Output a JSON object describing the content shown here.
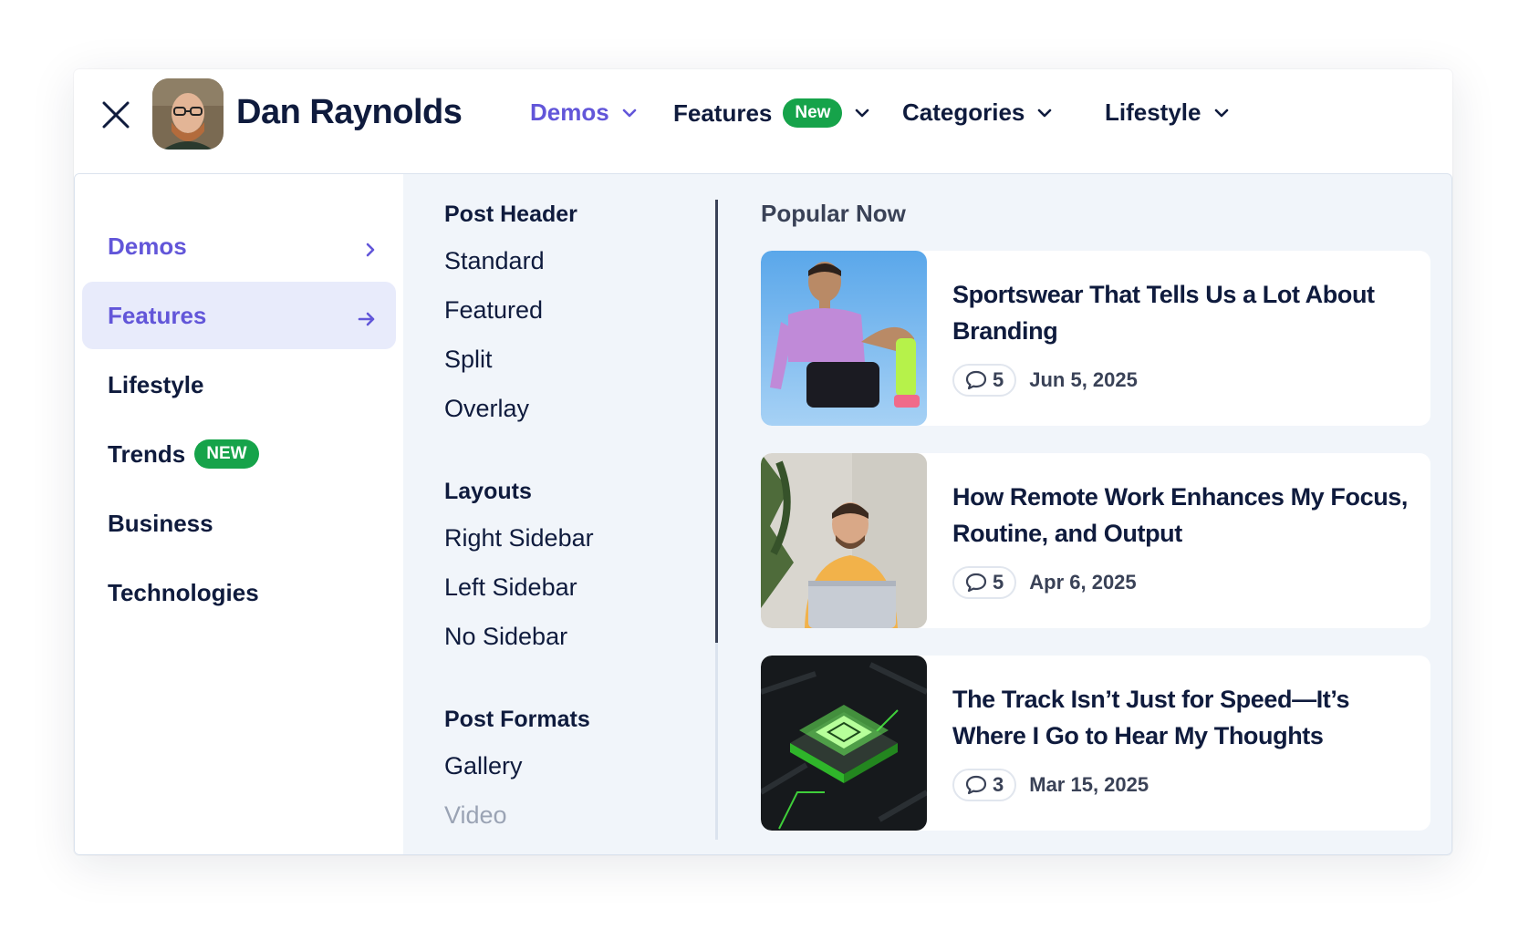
{
  "header": {
    "brand": "Dan Raynolds",
    "nav": [
      {
        "label": "Demos",
        "active": true
      },
      {
        "label": "Features",
        "badge": "New"
      },
      {
        "label": "Categories"
      },
      {
        "label": "Lifestyle"
      }
    ]
  },
  "menu": {
    "categories": [
      {
        "label": "Demos"
      },
      {
        "label": "Features"
      },
      {
        "label": "Lifestyle"
      },
      {
        "label": "Trends",
        "badge": "NEW"
      },
      {
        "label": "Business"
      },
      {
        "label": "Technologies"
      }
    ],
    "sections": [
      {
        "title": "Post Header",
        "links": [
          "Standard",
          "Featured",
          "Split",
          "Overlay"
        ]
      },
      {
        "title": "Layouts",
        "links": [
          "Right Sidebar",
          "Left Sidebar",
          "No Sidebar"
        ]
      },
      {
        "title": "Post Formats",
        "links": [
          "Gallery",
          "Video"
        ]
      }
    ]
  },
  "popular": {
    "title": "Popular Now",
    "posts": [
      {
        "title": "Sportswear That Tells Us a Lot About Branding",
        "comments": "5",
        "date": "Jun 5, 2025"
      },
      {
        "title": "How Remote Work Enhances My Focus, Routine, and Output",
        "comments": "5",
        "date": "Apr 6, 2025"
      },
      {
        "title": "The Track Isn’t Just for Speed—It’s Where I Go to Hear My Thoughts",
        "comments": "3",
        "date": "Mar 15, 2025"
      }
    ]
  },
  "colors": {
    "accent": "#6256d9",
    "badge": "#16a34a",
    "text": "#0f1b3d",
    "panel": "#f1f5fa"
  }
}
